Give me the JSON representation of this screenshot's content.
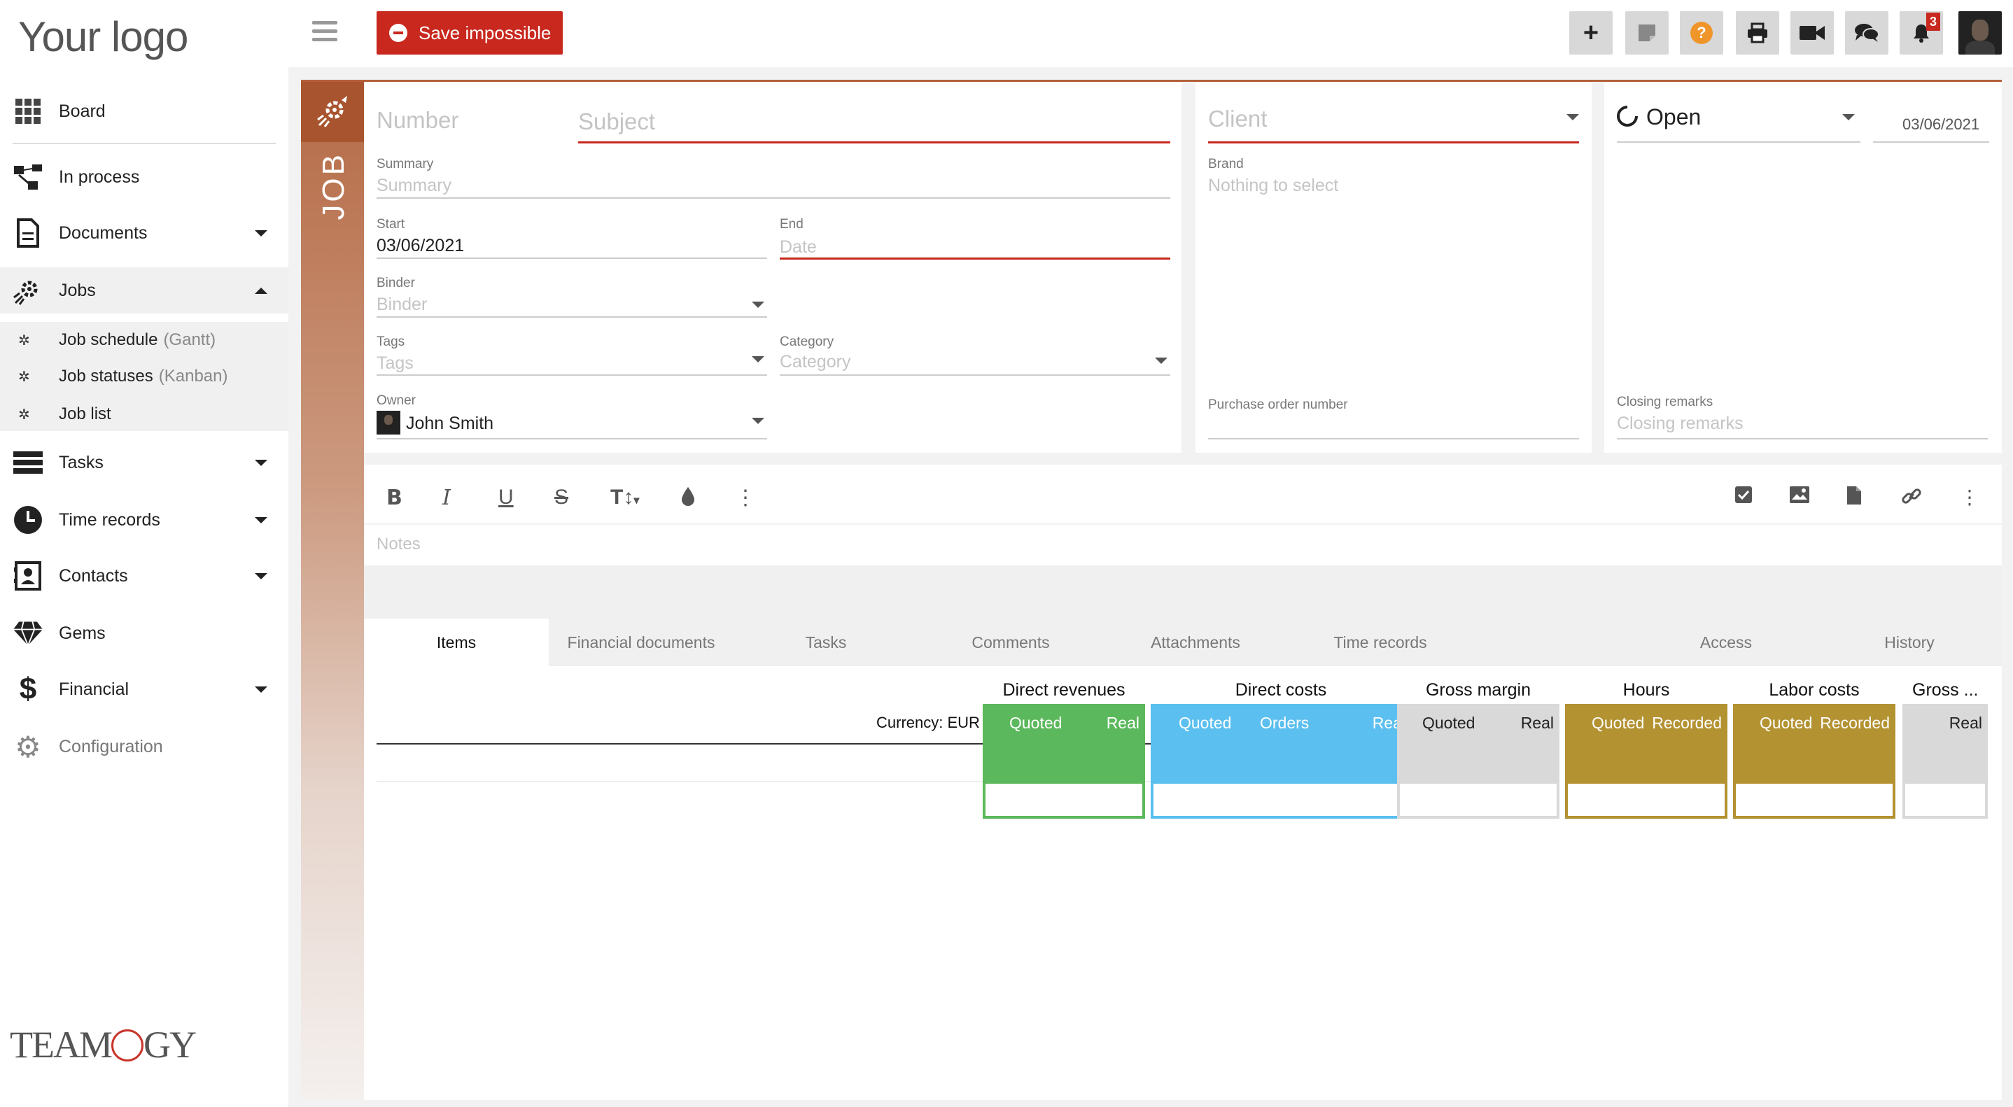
{
  "logo": "Your logo",
  "brand_footer": "TEAMOGY",
  "sidebar": {
    "items": [
      {
        "label": "Board"
      },
      {
        "label": "In process"
      },
      {
        "label": "Documents"
      },
      {
        "label": "Jobs"
      },
      {
        "label": "Tasks"
      },
      {
        "label": "Time records"
      },
      {
        "label": "Contacts"
      },
      {
        "label": "Gems"
      },
      {
        "label": "Financial"
      },
      {
        "label": "Configuration"
      }
    ],
    "jobs_sub": [
      {
        "label": "Job schedule",
        "suffix": "(Gantt)"
      },
      {
        "label": "Job statuses",
        "suffix": "(Kanban)"
      },
      {
        "label": "Job list",
        "suffix": ""
      }
    ]
  },
  "toolbar": {
    "save_label": "Save impossible",
    "notification_count": "3"
  },
  "job": {
    "strip_label": "JOB",
    "number_placeholder": "Number",
    "subject_placeholder": "Subject",
    "summary_label": "Summary",
    "summary_placeholder": "Summary",
    "start_label": "Start",
    "start_value": "03/06/2021",
    "end_label": "End",
    "end_placeholder": "Date",
    "binder_label": "Binder",
    "binder_placeholder": "Binder",
    "tags_label": "Tags",
    "tags_placeholder": "Tags",
    "category_label": "Category",
    "category_placeholder": "Category",
    "owner_label": "Owner",
    "owner_value": "John Smith",
    "client_placeholder": "Client",
    "brand_label": "Brand",
    "brand_placeholder": "Nothing to select",
    "po_label": "Purchase order number",
    "status_value": "Open",
    "status_date": "03/06/2021",
    "closing_label": "Closing remarks",
    "closing_placeholder": "Closing remarks"
  },
  "editor": {
    "notes_placeholder": "Notes"
  },
  "tabs": [
    {
      "label": "Items"
    },
    {
      "label": "Financial documents"
    },
    {
      "label": "Tasks"
    },
    {
      "label": "Comments"
    },
    {
      "label": "Attachments"
    },
    {
      "label": "Time records"
    },
    {
      "label": "Access"
    },
    {
      "label": "History"
    }
  ],
  "items_table": {
    "currency": "Currency: EUR",
    "groups": [
      {
        "title": "Direct revenues",
        "color": "#5cb85c",
        "cols": [
          "Quoted",
          "Real"
        ]
      },
      {
        "title": "Direct costs",
        "color": "#5bbfef",
        "cols": [
          "Quoted",
          "Orders",
          "Real"
        ]
      },
      {
        "title": "Gross margin",
        "color": "#d9d9d9",
        "cols": [
          "Quoted",
          "Real"
        ]
      },
      {
        "title": "Hours",
        "color": "#b39232",
        "cols": [
          "Quoted",
          "Recorded"
        ]
      },
      {
        "title": "Labor costs",
        "color": "#b39232",
        "cols": [
          "Quoted",
          "Recorded"
        ]
      },
      {
        "title": "Gross ...",
        "color": "#d9d9d9",
        "cols": [
          "Real"
        ]
      }
    ]
  },
  "colors": {
    "accent": "#c8281e",
    "job_brown": "#b5603a"
  }
}
